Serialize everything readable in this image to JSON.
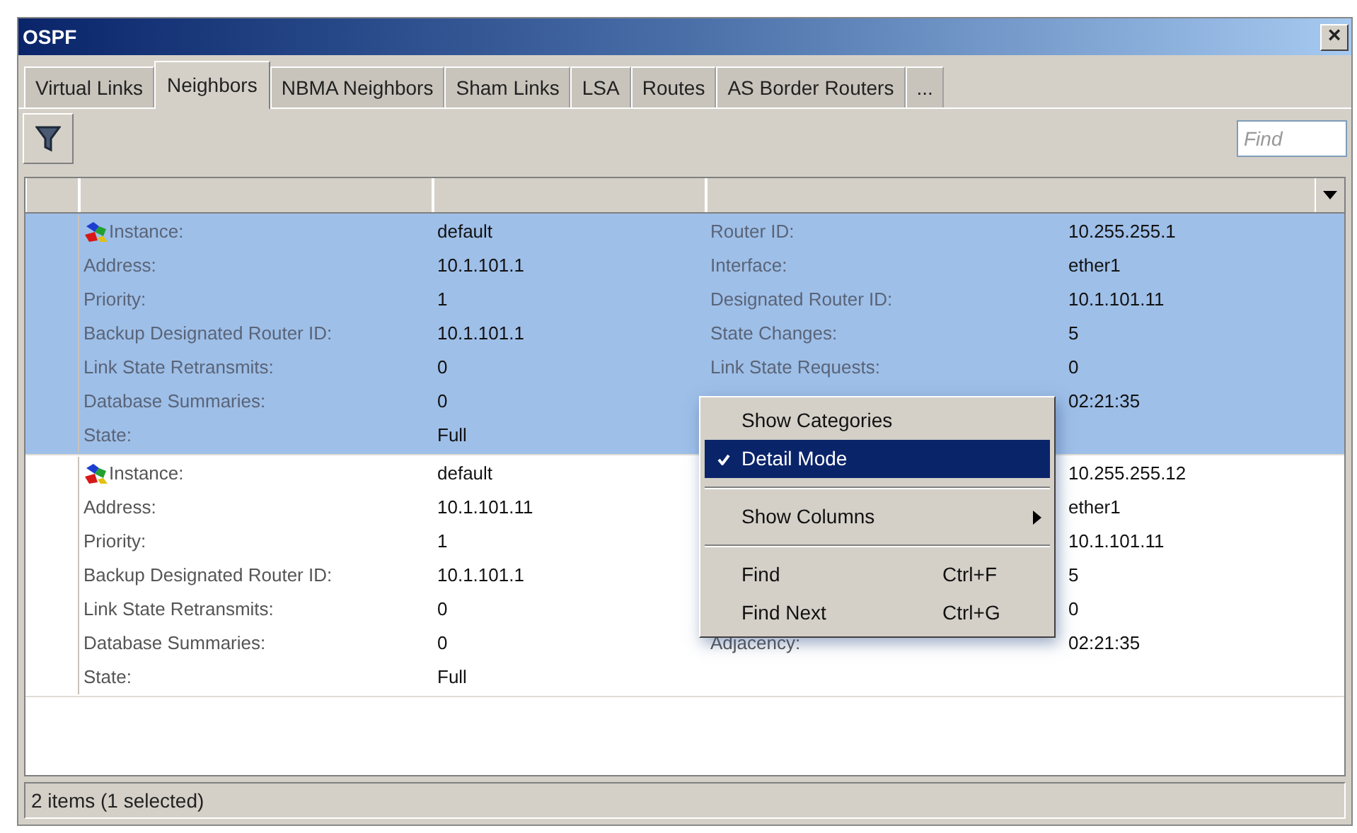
{
  "window": {
    "title": "OSPF",
    "close": "×"
  },
  "tabs": [
    {
      "label": "Virtual Links",
      "selected": false
    },
    {
      "label": "Neighbors",
      "selected": true
    },
    {
      "label": "NBMA Neighbors",
      "selected": false
    },
    {
      "label": "Sham Links",
      "selected": false
    },
    {
      "label": "LSA",
      "selected": false
    },
    {
      "label": "Routes",
      "selected": false
    },
    {
      "label": "AS Border Routers",
      "selected": false
    },
    {
      "label": "...",
      "selected": false
    }
  ],
  "search": {
    "placeholder": "Find"
  },
  "rows": [
    {
      "selected": true,
      "left": [
        {
          "label": "Instance:",
          "value": "default"
        },
        {
          "label": "Address:",
          "value": "10.1.101.1"
        },
        {
          "label": "Priority:",
          "value": "1"
        },
        {
          "label": "Backup Designated Router ID:",
          "value": "10.1.101.1"
        },
        {
          "label": "Link State Retransmits:",
          "value": "0"
        },
        {
          "label": "Database Summaries:",
          "value": "0"
        },
        {
          "label": "State:",
          "value": "Full"
        }
      ],
      "right": [
        {
          "label": "Router ID:",
          "value": "10.255.255.1"
        },
        {
          "label": "Interface:",
          "value": "ether1"
        },
        {
          "label": "Designated Router ID:",
          "value": "10.1.101.11"
        },
        {
          "label": "State Changes:",
          "value": "5"
        },
        {
          "label": "Link State Requests:",
          "value": "0"
        },
        {
          "value": "02:21:35"
        }
      ]
    },
    {
      "selected": false,
      "left": [
        {
          "label": "Instance:",
          "value": "default"
        },
        {
          "label": "Address:",
          "value": "10.1.101.11"
        },
        {
          "label": "Priority:",
          "value": "1"
        },
        {
          "label": "Backup Designated Router ID:",
          "value": "10.1.101.1"
        },
        {
          "label": "Link State Retransmits:",
          "value": "0"
        },
        {
          "label": "Database Summaries:",
          "value": "0"
        },
        {
          "label": "State:",
          "value": "Full"
        }
      ],
      "right": [
        {
          "value": "10.255.255.12"
        },
        {
          "value": "ether1"
        },
        {
          "value": "10.1.101.11"
        },
        {
          "value": "5"
        },
        {
          "value": "0"
        },
        {
          "label": "Adjacency:",
          "value": "02:21:35"
        }
      ]
    }
  ],
  "context_menu": [
    {
      "kind": "item",
      "label": "Show Categories",
      "checked": false,
      "selected": false
    },
    {
      "kind": "item",
      "label": "Detail Mode",
      "checked": true,
      "selected": true
    },
    {
      "kind": "separator"
    },
    {
      "kind": "submenu",
      "label": "Show Columns",
      "checked": false,
      "selected": false
    },
    {
      "kind": "separator"
    },
    {
      "kind": "item",
      "label": "Find",
      "shortcut": "Ctrl+F",
      "checked": false,
      "selected": false
    },
    {
      "kind": "item",
      "label": "Find Next",
      "shortcut": "Ctrl+G",
      "checked": false,
      "selected": false
    }
  ],
  "status_bar": "2 items (1 selected)"
}
